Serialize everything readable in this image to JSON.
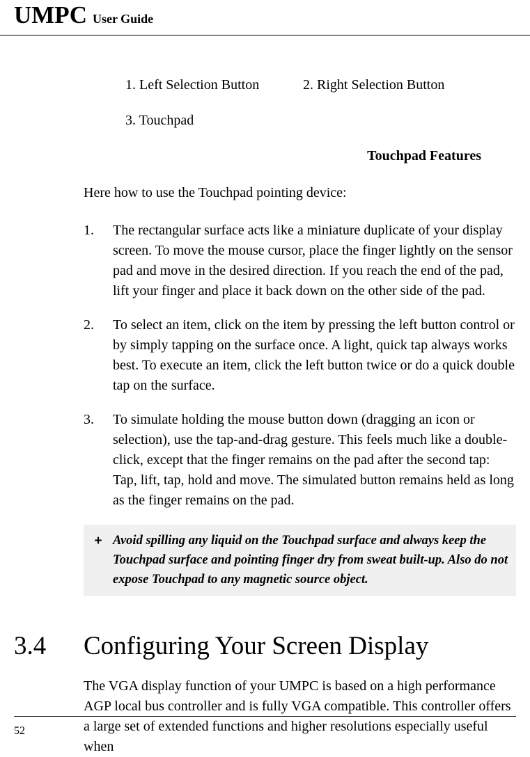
{
  "header": {
    "title_big": "UMPC",
    "title_small": "User Guide"
  },
  "legend": {
    "item1": "1. Left Selection Button",
    "item2": "2. Right Selection Button",
    "item3": "3. Touchpad"
  },
  "subtitle": "Touchpad Features",
  "intro": "Here how to use the Touchpad pointing device:",
  "list": {
    "n1": "1.",
    "t1": "The rectangular surface acts like a miniature duplicate of your display screen. To move the mouse cursor, place the finger lightly on the sensor pad and move in the desired direction. If you reach the end of the pad, lift your finger and place it back down on the other side of the pad.",
    "n2": "2.",
    "t2": "To select an item, click on the item by pressing the left button control or by simply tapping on the surface once. A light, quick tap always works best. To execute an item, click the left button twice or do a quick double tap on the surface.",
    "n3": "3.",
    "t3": "To simulate holding the mouse button down (dragging an icon or selection), use the tap-and-drag gesture. This feels much like a double-click, except that the finger remains on the pad after the second tap: Tap, lift, tap, hold and move. The simulated button remains held as long as the finger remains on the pad."
  },
  "note": {
    "symbol": "+",
    "text": "Avoid spilling any liquid on the Touchpad surface and always keep the Touchpad surface and pointing finger dry from sweat built-up. Also do not expose Touchpad to any magnetic source object."
  },
  "section": {
    "number": "3.4",
    "title": "Configuring Your Screen Display",
    "body": "The VGA display function of your UMPC is based on a high performance AGP local bus controller and is fully VGA compatible. This controller offers a large set of extended functions and higher resolutions especially useful when"
  },
  "page_number": "52"
}
